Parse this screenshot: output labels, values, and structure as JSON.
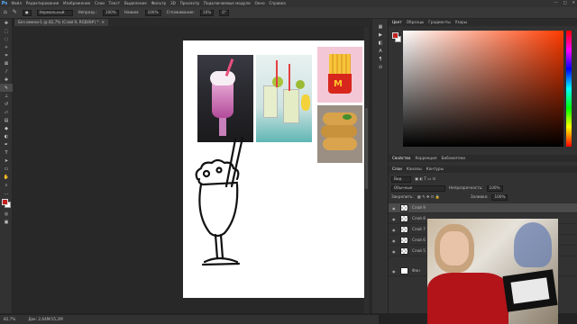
{
  "app": {
    "logo": "Ps"
  },
  "menu": [
    "Файл",
    "Редактирование",
    "Изображение",
    "Слои",
    "Текст",
    "Выделение",
    "Фильтр",
    "3D",
    "Просмотр",
    "Подключаемые модули",
    "Окно",
    "Справка"
  ],
  "options": {
    "autoselect": "Группа",
    "blend_label": "Нормальный",
    "opacity_label": "Непрозр.:",
    "opacity_value": "100%",
    "flow_label": "Нажим:",
    "flow_value": "100%",
    "smooth_label": "Сглаживание:",
    "smooth_value": "10%",
    "angle_value": "0°"
  },
  "document": {
    "tab_label": "Без имени-1 @ 82,7% (Слой 9, RGB/8#) *"
  },
  "status": {
    "zoom": "82,7%",
    "doc_size": "Док: 2,64М/15,2М"
  },
  "panels": {
    "color_tabs": [
      "Цвет",
      "Образцы",
      "Градиенты",
      "Узоры"
    ],
    "props_tabs": [
      "Свойства",
      "Коррекция",
      "Библиотеки"
    ],
    "layers_tabs": [
      "Слои",
      "Каналы",
      "Контуры"
    ],
    "kind_label": "Вид",
    "blend_mode": "Обычные",
    "opacity_label": "Непрозрачность:",
    "opacity_value": "100%",
    "lock_label": "Закрепить:",
    "fill_label": "Заливка:",
    "fill_value": "100%"
  },
  "layers": [
    "Слой 9",
    "Слой 8",
    "Слой 7",
    "Слой 6",
    "Слой 5",
    "Фон"
  ],
  "colors": {
    "foreground": "#c0201e",
    "background": "#ffffff",
    "accent": "#ff3b00"
  }
}
